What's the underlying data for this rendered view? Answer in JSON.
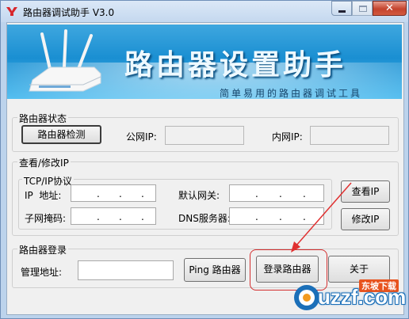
{
  "window": {
    "title": "路由器调试助手 V3.0",
    "close_glyph": "✕"
  },
  "banner": {
    "title": "路由器设置助手",
    "subtitle": "简单易用的路由器调试工具"
  },
  "router_status": {
    "legend": "路由器状态",
    "detect_button": "路由器检测",
    "public_ip_label": "公网IP:",
    "public_ip_value": "",
    "lan_ip_label": "内网IP:",
    "lan_ip_value": ""
  },
  "view_ip": {
    "legend": "查看/修改IP",
    "tcp_legend": "TCP/IP协议",
    "ip_label": "IP  地址:",
    "mask_label": "子网掩码:",
    "gateway_label": "默认网关:",
    "dns_label": "DNS服务器:",
    "ip_separator": ".",
    "view_button": "查看IP",
    "modify_button": "修改IP"
  },
  "login": {
    "legend": "路由器登录",
    "address_label": "管理地址:",
    "address_value": "",
    "ping_button": "Ping 路由器",
    "login_button": "登录路由器",
    "about_button": "关于"
  },
  "watermark": {
    "badge": "东坡下载",
    "text": "uzzf.com"
  },
  "colors": {
    "accent_banner": "#1a8fd2",
    "highlight": "#d32f2f",
    "close_button": "#c4432d",
    "watermark_orange": "#e8531e"
  },
  "icons": {
    "app": "router-app-icon",
    "minimize": "minimize-icon",
    "maximize": "maximize-icon",
    "close": "close-icon",
    "annotation_arrow": "red-arrow-icon"
  }
}
